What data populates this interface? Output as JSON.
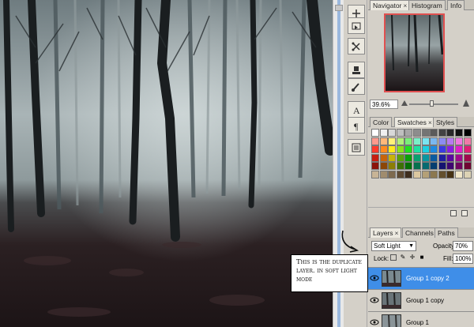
{
  "navigator_group": {
    "tabs": [
      {
        "label": "Navigator",
        "close": "×"
      },
      {
        "label": "Histogram"
      },
      {
        "label": "Info"
      }
    ],
    "zoom_value": "39.6%"
  },
  "swatches_group": {
    "tabs": [
      {
        "label": "Color"
      },
      {
        "label": "Swatches",
        "close": "×"
      },
      {
        "label": "Styles"
      }
    ],
    "colors": [
      "#ffffff",
      "#f0f0f0",
      "#d8d8d8",
      "#bfbfbf",
      "#a6a6a6",
      "#8d8d8d",
      "#747474",
      "#5b5b5b",
      "#424242",
      "#292929",
      "#101010",
      "#000000",
      "#ff9a8c",
      "#ffb87a",
      "#fff27a",
      "#b2f07a",
      "#7af07a",
      "#7af0c8",
      "#7ae4f0",
      "#7ab8f0",
      "#8c8cf0",
      "#b87af0",
      "#f07ae0",
      "#f07aa8",
      "#ff3b2b",
      "#ff8a1e",
      "#ffe81e",
      "#8ae01e",
      "#1ee01e",
      "#1ee0a0",
      "#1ecfe0",
      "#1e8ae0",
      "#3b3be0",
      "#8a1ee0",
      "#e01ec8",
      "#e01e74",
      "#c81e10",
      "#c8640a",
      "#c8b40a",
      "#5aa00a",
      "#0aa00a",
      "#0aa070",
      "#0a96a0",
      "#0a5aa0",
      "#1e1ea0",
      "#5a0aa0",
      "#a00a8c",
      "#a00a4c",
      "#8c140a",
      "#8c4606",
      "#8c7e06",
      "#3e7006",
      "#067006",
      "#06704e",
      "#066a70",
      "#063e70",
      "#141470",
      "#3e0670",
      "#70065e",
      "#700632",
      "#c8b496",
      "#a08c6e",
      "#7e6a4e",
      "#5e4a32",
      "#3e2e1e",
      "#dcc8a0",
      "#b4a078",
      "#8c7850",
      "#64502e",
      "#463214",
      "#f0e6c8",
      "#dcd2b4"
    ]
  },
  "layers_group": {
    "tabs": [
      {
        "label": "Layers",
        "close": "×"
      },
      {
        "label": "Channels"
      },
      {
        "label": "Paths"
      }
    ],
    "blend_mode": "Soft Light",
    "opacity_label": "Opacity:",
    "opacity_value": "70%",
    "lock_label": "Lock:",
    "fill_label": "Fill:",
    "fill_value": "100%",
    "layers": [
      {
        "name": "Group 1 copy 2",
        "visible": true,
        "selected": true
      },
      {
        "name": "Group 1 copy",
        "visible": true,
        "selected": false
      },
      {
        "name": "Group 1",
        "visible": true,
        "selected": false
      }
    ]
  },
  "callout": {
    "text": "This is the duplicate layer. in soft light mode"
  },
  "colors": {
    "selection": "#3f8ee8",
    "navigator_frame": "#e05050",
    "panel_bg": "#d4d0c8"
  },
  "tool_icons": [
    "move-icon",
    "slice-icon",
    "crop-icon",
    "stamp-icon",
    "brush-icon",
    "text-icon",
    "path-icon",
    "notes-icon"
  ]
}
